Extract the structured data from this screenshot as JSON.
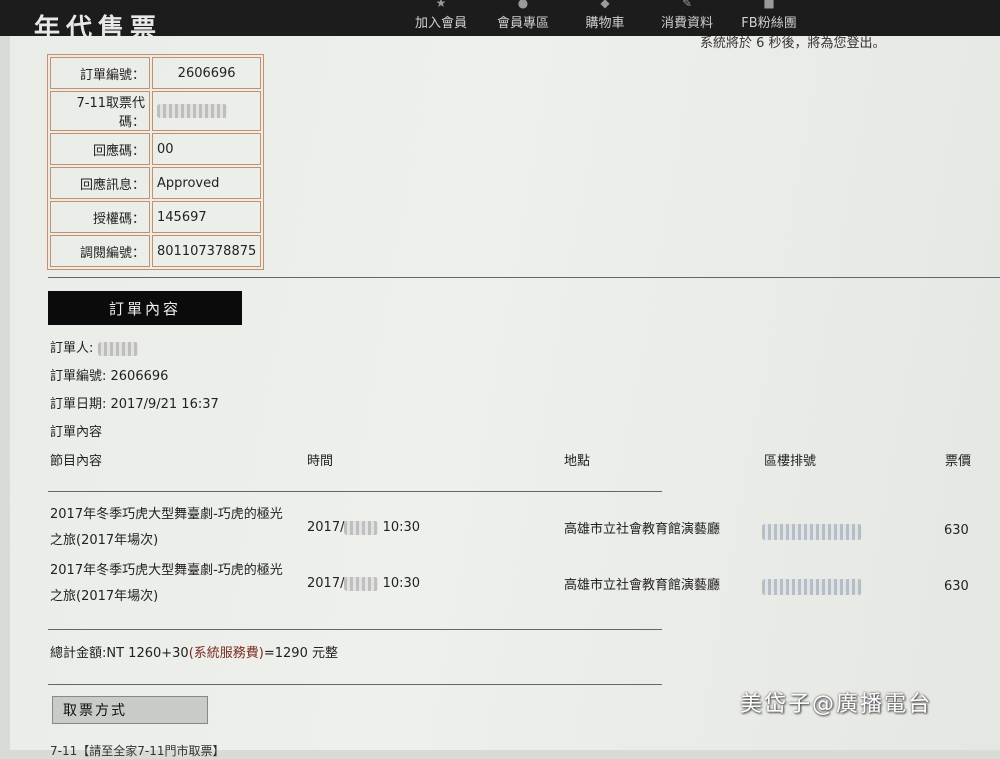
{
  "header": {
    "logo_text": "年代售票",
    "nav": [
      {
        "label": "加入會員",
        "icon": "star-icon"
      },
      {
        "label": "會員專區",
        "icon": "person-icon"
      },
      {
        "label": "購物車",
        "icon": "cart-icon"
      },
      {
        "label": "消費資料",
        "icon": "pen-icon"
      },
      {
        "label": "FB粉絲團",
        "icon": "facebook-icon"
      }
    ]
  },
  "notice": {
    "logout": "系統將於 6 秒後，將為您登出。"
  },
  "payment": {
    "rows": [
      {
        "label": "訂單編號：",
        "value": "2606696"
      },
      {
        "label": "7-11取票代碼：",
        "value": ""
      },
      {
        "label": "回應碼：",
        "value": "00"
      },
      {
        "label": "回應訊息：",
        "value": "Approved"
      },
      {
        "label": "授權碼：",
        "value": "145697"
      },
      {
        "label": "調閱編號：",
        "value": "801107378875"
      }
    ]
  },
  "order": {
    "section_title": "訂單內容",
    "buyer_label": "訂單人:",
    "number_line": "訂單編號: 2606696",
    "date_line": "訂單日期: 2017/9/21 16:37",
    "content_label": "訂單內容",
    "columns": [
      "節目內容",
      "時間",
      "地點",
      "區樓排號",
      "票價"
    ],
    "items": [
      {
        "name_1": "2017年冬季巧虎大型舞臺劇-巧虎的極光",
        "name_2": "之旅(2017年場次)",
        "time_prefix": "2017/",
        "time_suffix": "10:30",
        "venue": "高雄市立社會教育館演藝廳",
        "price": "630"
      },
      {
        "name_1": "2017年冬季巧虎大型舞臺劇-巧虎的極光",
        "name_2": "之旅(2017年場次)",
        "time_prefix": "2017/",
        "time_suffix": "10:30",
        "venue": "高雄市立社會教育館演藝廳",
        "price": "630"
      }
    ],
    "total_prefix": "總計金額:NT 1260+30",
    "total_service": "(系統服務費)",
    "total_suffix": "=1290 元整"
  },
  "pickup": {
    "button_label": "取票方式",
    "partial_text": "7-11【請至全家7-11門市取票】"
  },
  "watermark": "美岱子@廣播電台"
}
